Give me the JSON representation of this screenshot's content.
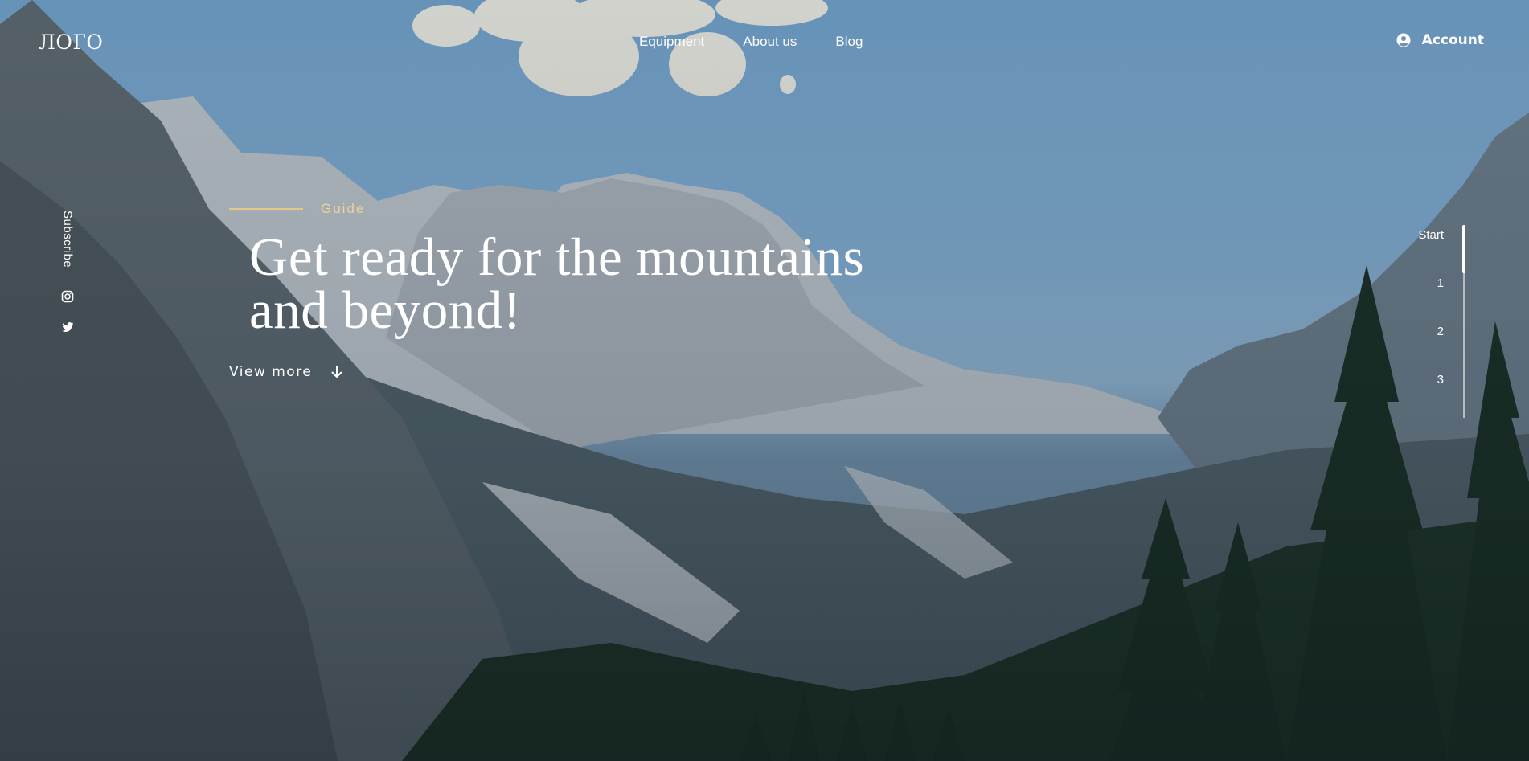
{
  "header": {
    "logo": "ЛОГО",
    "nav": [
      {
        "label": "Equipment"
      },
      {
        "label": "About us"
      },
      {
        "label": "Blog"
      }
    ],
    "account_label": "Account",
    "account_icon": "user-circle-icon"
  },
  "rail": {
    "subscribe_label": "Subscribe",
    "social": [
      {
        "icon": "instagram-icon"
      },
      {
        "icon": "twitter-icon"
      }
    ]
  },
  "hero": {
    "eyebrow": "Guide",
    "title_line1": "Get ready for the mountains",
    "title_line2": "and beyond!",
    "cta_label": "View more",
    "cta_icon": "arrow-down-icon"
  },
  "slides": {
    "items": [
      "Start",
      "1",
      "2",
      "3"
    ],
    "active_index": 0
  },
  "colors": {
    "accent": "#e6c78a",
    "text": "#ffffff"
  }
}
